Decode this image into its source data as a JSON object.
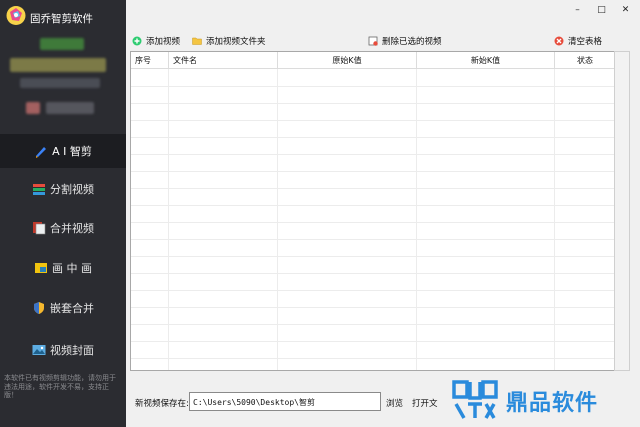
{
  "app": {
    "title": "固乔智剪软件"
  },
  "window_controls": {
    "minimize": "–",
    "maximize": "□",
    "close": "✕"
  },
  "sidebar": {
    "items": [
      {
        "label": "A I 智剪",
        "icon": "ai-pen-icon",
        "active": true
      },
      {
        "label": "分割视频",
        "icon": "stack-icon",
        "active": false
      },
      {
        "label": "合并视频",
        "icon": "merge-icon",
        "active": false
      },
      {
        "label": "画 中 画",
        "icon": "picture-in-picture-icon",
        "active": false
      },
      {
        "label": "嵌套合并",
        "icon": "shield-icon",
        "active": false
      },
      {
        "label": "视频封面",
        "icon": "image-icon",
        "active": false
      }
    ],
    "note": "本软件已有视频剪辑功能，请勿用于违法用途，软件开发不易，支持正版！"
  },
  "toolbar": {
    "add_video": "添加视频",
    "add_folder": "添加视频文件夹",
    "delete_selected": "删除已选的视频",
    "clear_table": "清空表格"
  },
  "table": {
    "columns": [
      "序号",
      "文件名",
      "原始K值",
      "新始K值",
      "状态"
    ],
    "rows": []
  },
  "footer": {
    "save_label": "新视频保存在:",
    "save_path": "C:\\Users\\5090\\Desktop\\智剪",
    "browse": "浏览",
    "open_folder": "打开文"
  },
  "watermark": {
    "text": "鼎品软件"
  },
  "colors": {
    "sidebar_bg": "#2b2c31",
    "active_bg": "#1c1d21",
    "brand_blue": "#2a8bdc"
  }
}
